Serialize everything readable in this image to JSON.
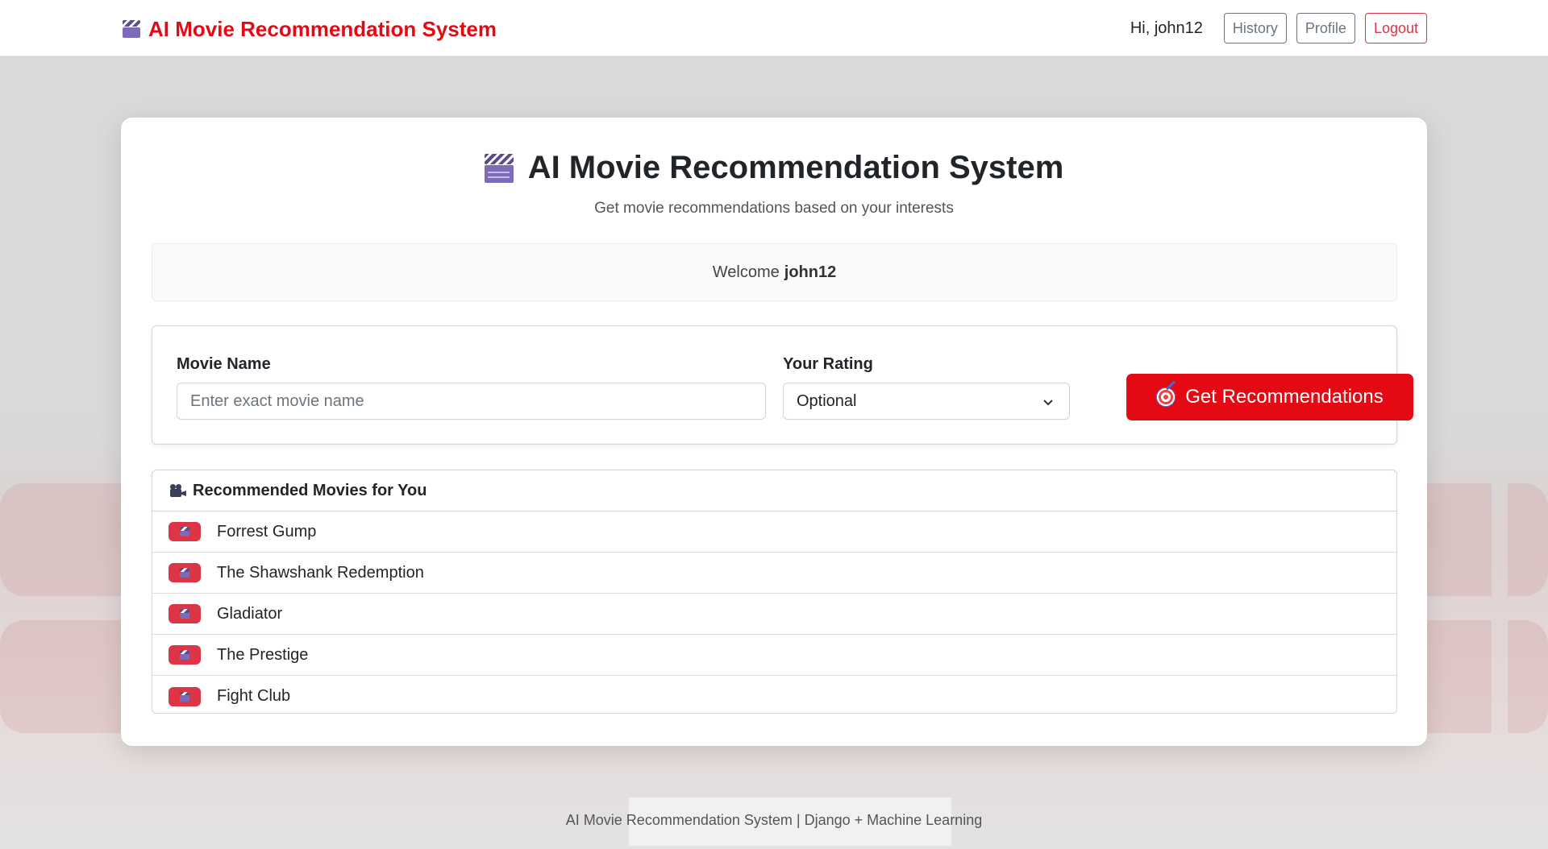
{
  "navbar": {
    "brand": "AI Movie Recommendation System",
    "greeting": "Hi, john12",
    "history_label": "History",
    "profile_label": "Profile",
    "logout_label": "Logout"
  },
  "hero": {
    "title": "AI Movie Recommendation System",
    "subtitle": "Get movie recommendations based on your interests"
  },
  "welcome": {
    "prefix": "Welcome",
    "username": "john12"
  },
  "form": {
    "movie_label": "Movie Name",
    "movie_placeholder": "Enter exact movie name",
    "movie_value": "",
    "rating_label": "Your Rating",
    "rating_selected": "Optional",
    "submit_label": "Get Recommendations"
  },
  "recommendations": {
    "heading": "Recommended Movies for You",
    "items": [
      {
        "title": "Forrest Gump"
      },
      {
        "title": "The Shawshank Redemption"
      },
      {
        "title": "Gladiator"
      },
      {
        "title": "The Prestige"
      },
      {
        "title": "Fight Club"
      }
    ]
  },
  "footer": {
    "text": "AI Movie Recommendation System | Django + Machine Learning"
  },
  "colors": {
    "brand": "#e50914",
    "logout": "#dc3545",
    "badge": "#dc3545"
  },
  "icons": {
    "brand_icon": "clapperboard-icon",
    "hero_icon": "clapperboard-icon",
    "submit_icon": "target-icon",
    "recommend_icon": "movie-camera-icon",
    "row_icon": "clapperboard-icon",
    "select_icon": "chevron-down-icon"
  }
}
